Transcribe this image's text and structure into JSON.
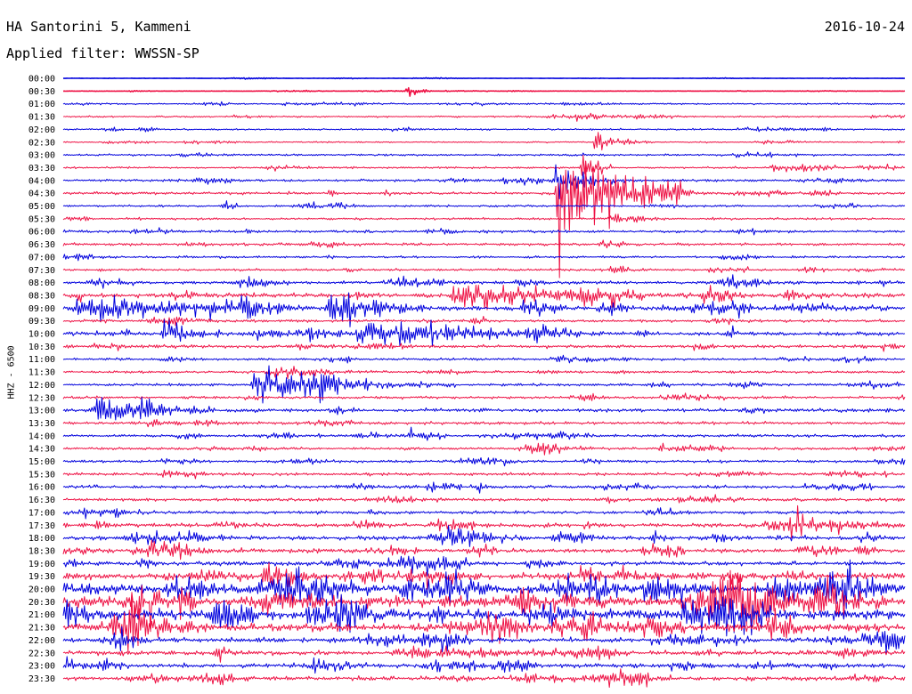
{
  "header": {
    "station": "HA Santorini 5, Kammeni",
    "date": "2016-10-24",
    "filter": "Applied filter: WWSSN-SP",
    "channel_label": "HHZ - 6500"
  },
  "colors": {
    "trace_a": "#0000dd",
    "trace_b": "#ee1144",
    "background": "#ffffff",
    "text": "#000000"
  },
  "chart_data": {
    "type": "helicorder",
    "title": "HA Santorini 5, Kammeni",
    "date": "2016-10-24",
    "filter": "WWSSN-SP",
    "channel": "HHZ - 6500",
    "lines_per_day": 48,
    "minutes_per_line": 30,
    "tick_labels": [
      "00:00",
      "00:30",
      "01:00",
      "01:30",
      "02:00",
      "02:30",
      "03:00",
      "03:30",
      "04:00",
      "04:30",
      "05:00",
      "05:30",
      "06:00",
      "06:30",
      "07:00",
      "07:30",
      "08:00",
      "08:30",
      "09:00",
      "09:30",
      "10:00",
      "10:30",
      "11:00",
      "11:30",
      "12:00",
      "12:30",
      "13:00",
      "13:30",
      "14:00",
      "14:30",
      "15:00",
      "15:30",
      "16:00",
      "16:30",
      "17:00",
      "17:30",
      "18:00",
      "18:30",
      "19:00",
      "19:30",
      "20:00",
      "20:30",
      "21:00",
      "21:30",
      "22:00",
      "22:30",
      "23:00",
      "23:30"
    ],
    "trace_colors": [
      "#0000dd",
      "#ee1144"
    ],
    "noise_amplitude": [
      0.3,
      0.4,
      1.3,
      1.4,
      1.4,
      1.2,
      1.8,
      1.6,
      2.0,
      2.3,
      1.7,
      1.9,
      2.2,
      2.2,
      1.8,
      2.0,
      2.6,
      3.8,
      4.6,
      2.3,
      3.2,
      2.7,
      2.1,
      2.1,
      2.2,
      2.2,
      3.0,
      2.4,
      2.2,
      2.2,
      2.2,
      2.4,
      2.6,
      2.6,
      2.6,
      3.6,
      3.8,
      3.8,
      3.4,
      5.5,
      8.5,
      9.0,
      8.5,
      7.0,
      4.0,
      3.8,
      3.6,
      3.4
    ],
    "events": [
      {
        "line": 1,
        "minute": 12.3,
        "amplitude": 5,
        "duration_min": 0.4
      },
      {
        "line": 5,
        "minute": 18.9,
        "amplitude": 10,
        "duration_min": 0.9
      },
      {
        "line": 7,
        "minute": 18.5,
        "amplitude": 12,
        "duration_min": 0.5
      },
      {
        "line": 8,
        "minute": 17.5,
        "amplitude": 20,
        "duration_min": 0.8
      },
      {
        "line": 9,
        "minute": 17.6,
        "amplitude": 60,
        "duration_min": 2.0
      },
      {
        "line": 17,
        "minute": 13.8,
        "amplitude": 10,
        "duration_min": 3.5
      },
      {
        "line": 18,
        "minute": 9.5,
        "amplitude": 12,
        "duration_min": 1.6
      },
      {
        "line": 18,
        "minute": 0.5,
        "amplitude": 10,
        "duration_min": 3.5
      },
      {
        "line": 20,
        "minute": 3.5,
        "amplitude": 10,
        "duration_min": 1.0
      },
      {
        "line": 20,
        "minute": 10.5,
        "amplitude": 10,
        "duration_min": 4.0
      },
      {
        "line": 24,
        "minute": 6.8,
        "amplitude": 18,
        "duration_min": 1.5
      },
      {
        "line": 24,
        "minute": 8.5,
        "amplitude": 8,
        "duration_min": 2.5
      },
      {
        "line": 26,
        "minute": 1.1,
        "amplitude": 10,
        "duration_min": 2.0
      },
      {
        "line": 28,
        "minute": 12.2,
        "amplitude": 6,
        "duration_min": 0.8
      }
    ]
  }
}
